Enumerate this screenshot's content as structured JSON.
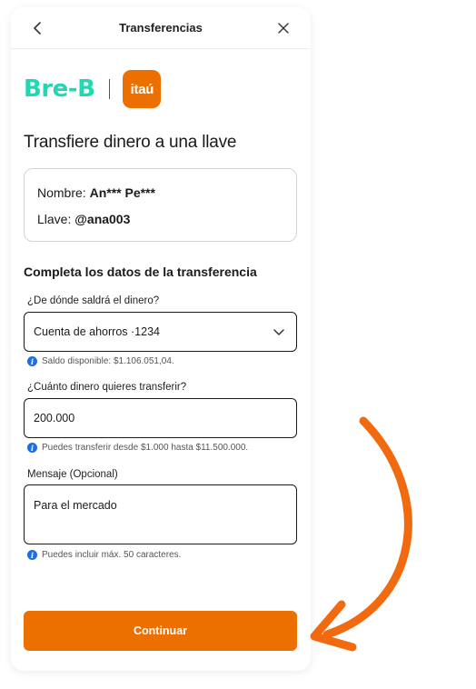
{
  "header": {
    "title": "Transferencias",
    "back_icon": "chevron-left-icon",
    "close_icon": "close-icon"
  },
  "logos": {
    "breb": "Bre-B",
    "itau": "itaú",
    "itau_color": "#ec7000",
    "breb_color": "#20d8b2"
  },
  "page_title": "Transfiere dinero a una llave",
  "recipient": {
    "name_label": "Nombre: ",
    "name_value": "An*** Pe***",
    "key_label": "Llave: ",
    "key_value": "@ana003"
  },
  "form": {
    "section_title": "Completa los datos de la transferencia",
    "source": {
      "label": "¿De dónde saldrá el dinero?",
      "value": "Cuenta de ahorros ·1234",
      "hint": "Saldo disponible: $1.106.051,04."
    },
    "amount": {
      "label": "¿Cuánto dinero quieres transferir?",
      "value": "200.000",
      "hint": "Puedes transferir desde $1.000 hasta $11.500.000."
    },
    "message": {
      "label": "Mensaje (Opcional)",
      "value": "Para el mercado",
      "hint": "Puedes incluir máx. 50 caracteres."
    }
  },
  "continue_label": "Continuar",
  "info_icon": "info-icon",
  "accent_color": "#ec7000",
  "info_color": "#1e6fd9"
}
